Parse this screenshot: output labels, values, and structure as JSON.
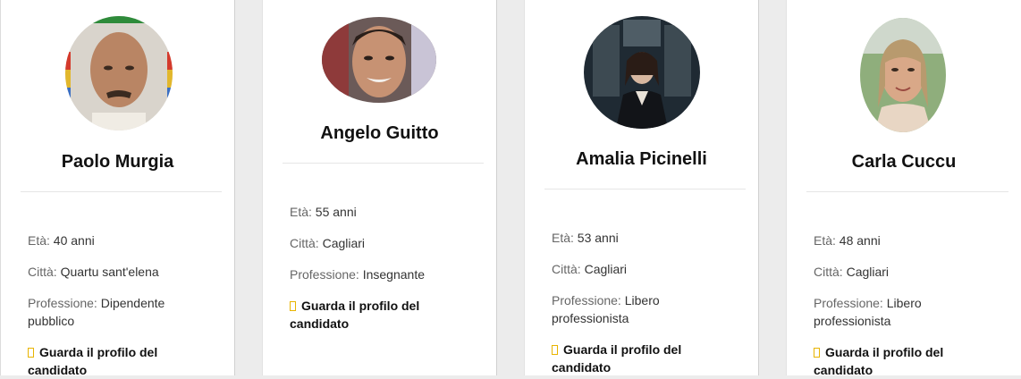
{
  "cards": [
    {
      "name": "Paolo Murgia",
      "age_label": "Età: ",
      "age": "40 anni",
      "city_label": "Città: ",
      "city": "Quartu sant'elena",
      "job_label": "Professione: ",
      "job": "Dipendente pubblico",
      "link": "Guarda il profilo del candidato"
    },
    {
      "name": "Angelo Guitto",
      "age_label": "Età: ",
      "age": "55 anni",
      "city_label": "Città: ",
      "city": "Cagliari",
      "job_label": "Professione: ",
      "job": "Insegnante",
      "link": "Guarda il profilo del candidato"
    },
    {
      "name": "Amalia Picinelli",
      "age_label": "Età: ",
      "age": "53 anni",
      "city_label": "Città: ",
      "city": "Cagliari",
      "job_label": "Professione: ",
      "job": "Libero professionista",
      "link": "Guarda il profilo del candidato"
    },
    {
      "name": "Carla Cuccu",
      "age_label": "Età: ",
      "age": "48 anni",
      "city_label": "Città: ",
      "city": "Cagliari",
      "job_label": "Professione: ",
      "job": "Libero professionista",
      "link": "Guarda il profilo del candidato"
    }
  ],
  "colors": {
    "link_icon": "#e8b400",
    "background": "#ececec"
  }
}
